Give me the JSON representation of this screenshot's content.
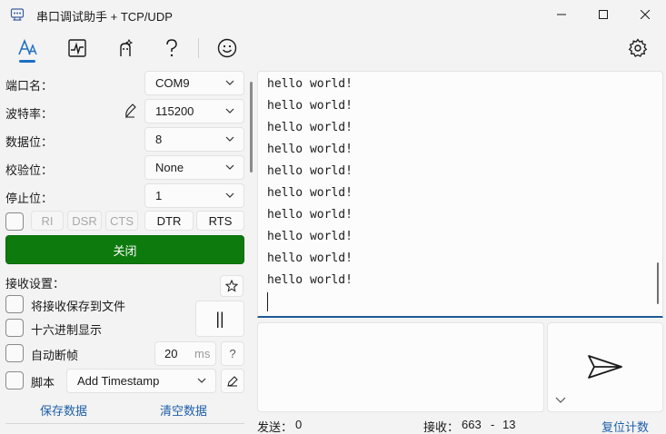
{
  "window": {
    "title": "串口调试助手 + TCP/UDP",
    "controls": [
      "minimize-icon",
      "maximize-icon",
      "close-icon"
    ]
  },
  "toolbar": {
    "icons": [
      "font-icon",
      "chart-icon",
      "magic-icon",
      "help-icon",
      "smiley-icon"
    ],
    "active": "font-icon",
    "right_icon": "gear-icon"
  },
  "serial": {
    "port_label": "端口名：",
    "port_value": "COM9",
    "baud_label": "波特率：",
    "baud_value": "115200",
    "databits_label": "数据位：",
    "databits_value": "8",
    "parity_label": "校验位：",
    "parity_value": "None",
    "stopbits_label": "停止位：",
    "stopbits_value": "1"
  },
  "pins": {
    "ri": "RI",
    "dsr": "DSR",
    "cts": "CTS",
    "dtr": "DTR",
    "rts": "RTS"
  },
  "close_button": "关闭",
  "receive_settings": {
    "title": "接收设置：",
    "save_to_file": "将接收保存到文件",
    "hex_display": "十六进制显示",
    "auto_frame": "自动断帧",
    "frame_value": "20",
    "frame_unit": "ms",
    "help": "?",
    "script_label": "脚本",
    "script_value": "Add Timestamp",
    "pause": "||"
  },
  "actions": {
    "save_data": "保存数据",
    "clear_data": "清空数据"
  },
  "receive_lines": [
    "hello world!",
    "hello world!",
    "hello world!",
    "hello world!",
    "hello world!",
    "hello world!",
    "hello world!",
    "hello world!",
    "hello world!",
    "hello world!"
  ],
  "status": {
    "sent_label": "发送：",
    "sent_value": "0",
    "recv_label": "接收：",
    "recv_value": "663",
    "recv_sep": "-",
    "recv_extra": "13",
    "reset": "复位计数"
  },
  "colors": {
    "accent": "#1e5a96",
    "close_button_bg": "#0d7a0d",
    "link": "#1e5fa8"
  }
}
